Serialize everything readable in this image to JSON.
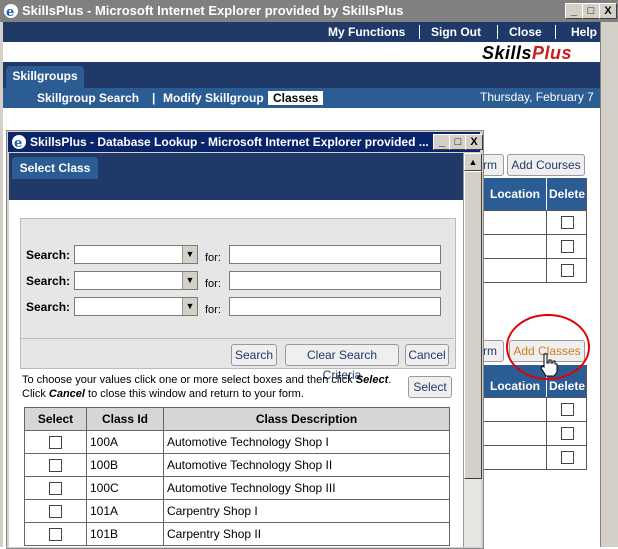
{
  "outer_window": {
    "title": "SkillsPlus - Microsoft Internet Explorer provided by SkillsPlus",
    "controls": [
      "_",
      "□",
      "X"
    ]
  },
  "top_nav": [
    "My Functions",
    "Sign Out",
    "Close",
    "Help"
  ],
  "logo": {
    "part1": "Skills",
    "part2": "Plus"
  },
  "main_tab": "Skillgroups",
  "sub_nav": [
    "Skillgroup Search",
    "|",
    "Modify Skillgroup",
    "Classes"
  ],
  "date": "Thursday, February 7",
  "background": {
    "partial_button_1": "rm",
    "add_courses": "Add Courses",
    "partial_button_2": "rm",
    "add_classes": "Add Classes",
    "col_location": "Location",
    "col_delete": "Delete"
  },
  "popup": {
    "title": "SkillsPlus - Database Lookup - Microsoft Internet Explorer provided ...",
    "tab": "Select Class",
    "search_label": "Search:",
    "for_label": "for:",
    "buttons": {
      "search": "Search",
      "clear": "Clear Search Criteria",
      "cancel": "Cancel",
      "select": "Select"
    },
    "instructions": {
      "line1a": "To choose your values click one or more select boxes and then click ",
      "line1b": "Select",
      "line1c": ".",
      "line2a": "Click ",
      "line2b": "Cancel",
      "line2c": " to close this window and return to your form."
    },
    "table": {
      "headers": [
        "Select",
        "Class Id",
        "Class Description"
      ],
      "rows": [
        {
          "id": "100A",
          "desc": "Automotive Technology Shop I"
        },
        {
          "id": "100B",
          "desc": "Automotive Technology Shop II"
        },
        {
          "id": "100C",
          "desc": "Automotive Technology Shop III"
        },
        {
          "id": "101A",
          "desc": "Carpentry Shop I"
        },
        {
          "id": "101B",
          "desc": "Carpentry Shop II"
        }
      ]
    }
  },
  "colors": {
    "nav_dark": "#1f3a68",
    "nav_mid": "#2c5c94",
    "logo_red": "#cc1c1c",
    "annotation": "#e00000"
  }
}
